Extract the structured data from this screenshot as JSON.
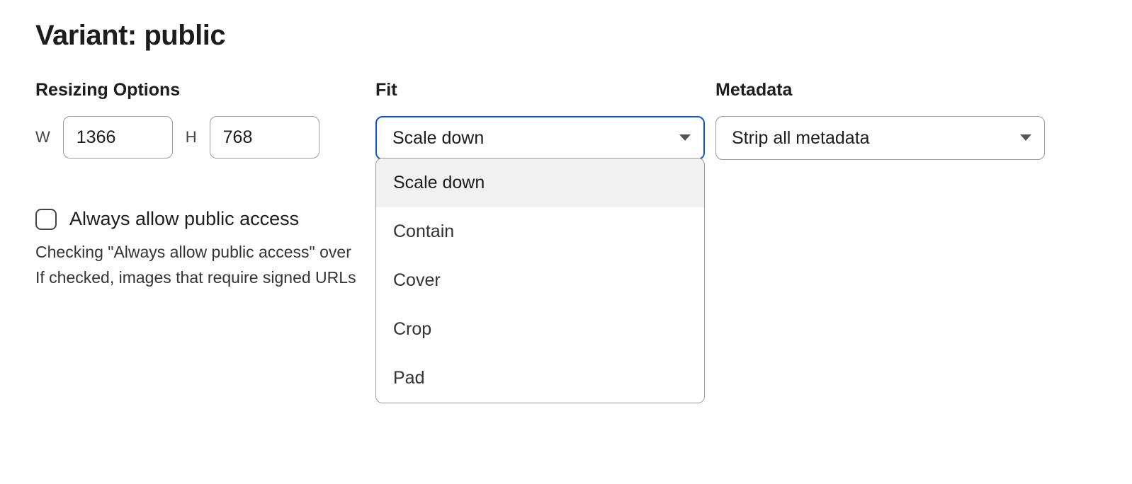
{
  "title": "Variant: public",
  "resizing": {
    "label": "Resizing Options",
    "w_label": "W",
    "w_value": "1366",
    "h_label": "H",
    "h_value": "768"
  },
  "fit": {
    "label": "Fit",
    "selected": "Scale down",
    "options": [
      "Scale down",
      "Contain",
      "Cover",
      "Crop",
      "Pad"
    ]
  },
  "metadata": {
    "label": "Metadata",
    "selected": "Strip all metadata"
  },
  "access": {
    "checkbox_label": "Always allow public access",
    "help_line1": "Checking \"Always allow public access\" over",
    "help_line2": "If checked, images that require signed URLs"
  }
}
